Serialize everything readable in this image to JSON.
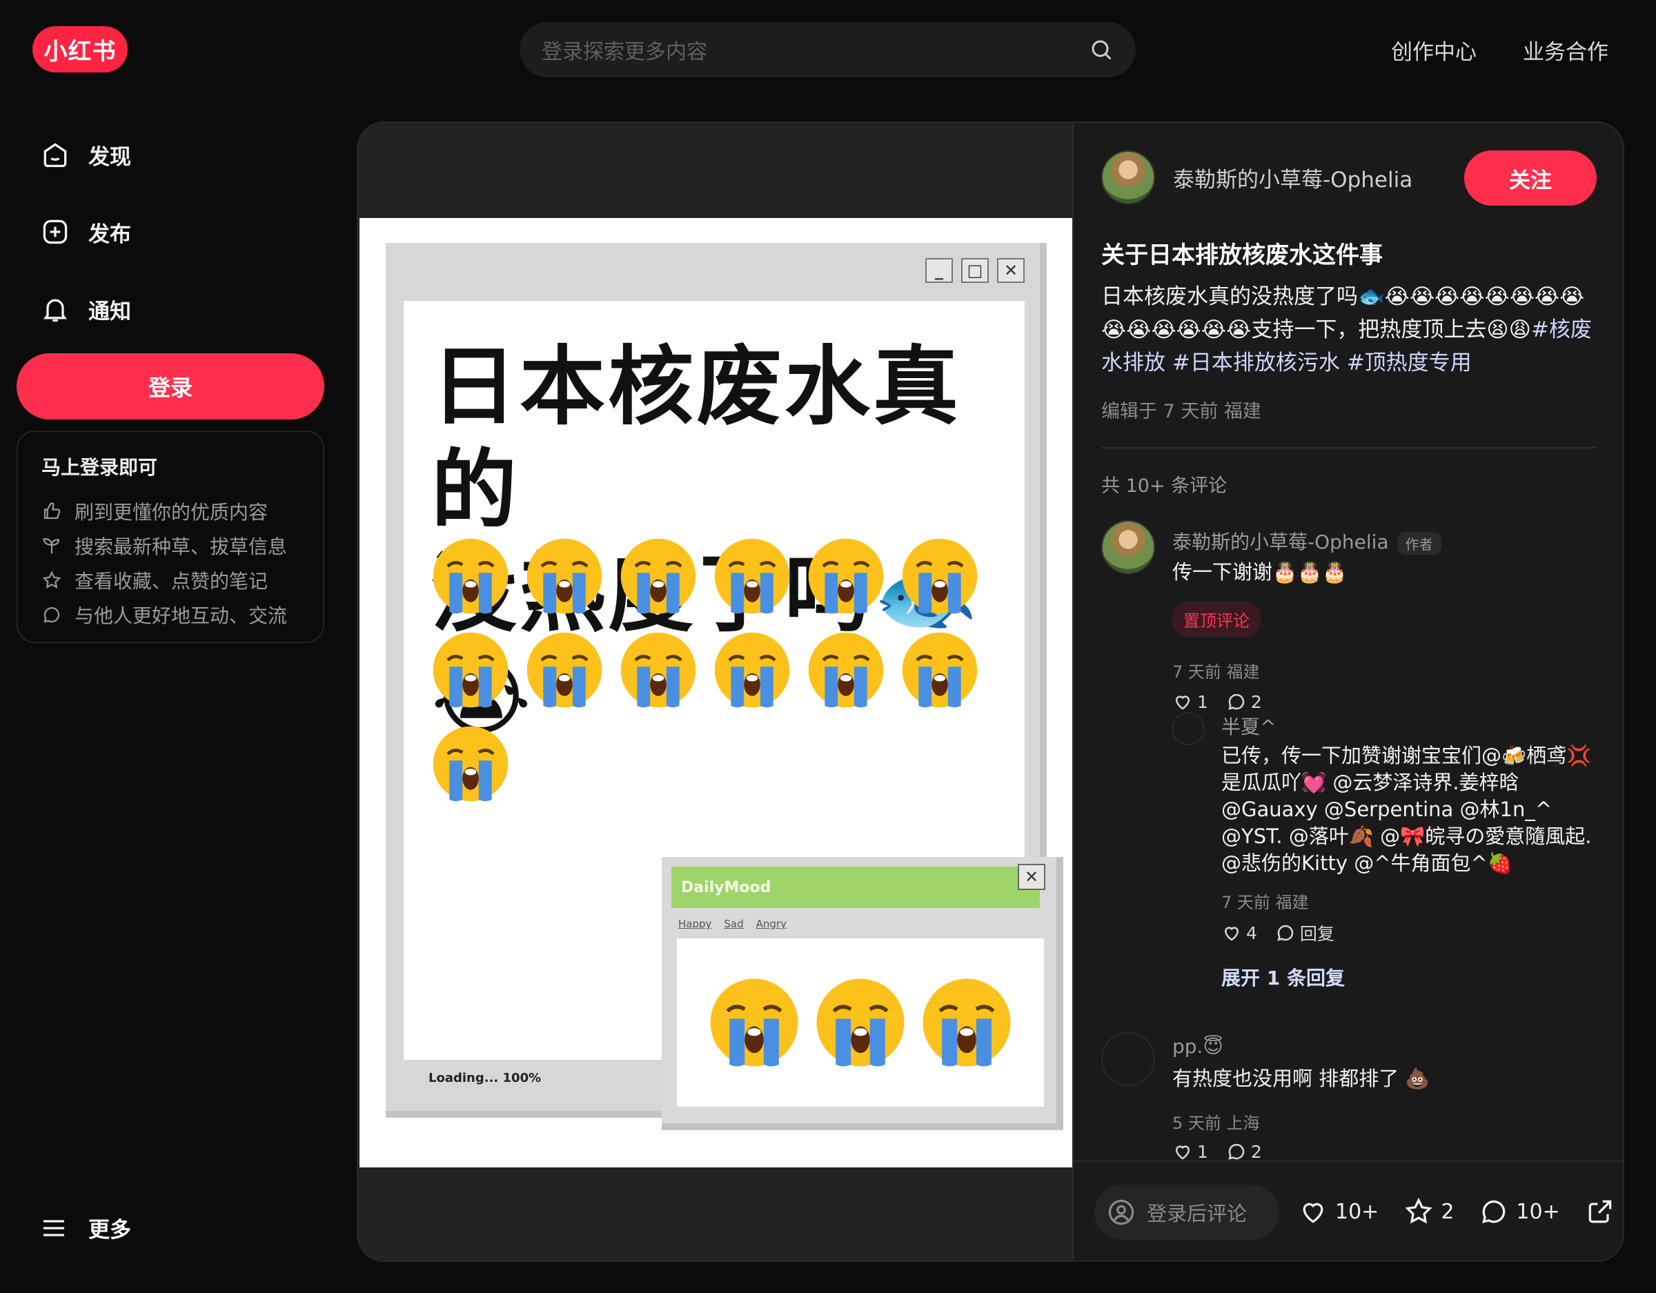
{
  "header": {
    "logo": "小红书",
    "search_placeholder": "登录探索更多内容",
    "links": [
      "创作中心",
      "业务合作"
    ]
  },
  "sidebar": {
    "items": [
      {
        "label": "发现",
        "icon": "home-icon"
      },
      {
        "label": "发布",
        "icon": "plus-square-icon"
      },
      {
        "label": "通知",
        "icon": "bell-icon"
      }
    ],
    "login_button": "登录",
    "login_card": {
      "title": "马上登录即可",
      "benefits": [
        {
          "text": "刷到更懂你的优质内容",
          "icon": "thumbs-up-icon"
        },
        {
          "text": "搜索最新种草、拔草信息",
          "icon": "sprout-icon"
        },
        {
          "text": "查看收藏、点赞的笔记",
          "icon": "star-icon"
        },
        {
          "text": "与他人更好地互动、交流",
          "icon": "chat-bubble-icon"
        }
      ]
    },
    "more": "更多"
  },
  "media": {
    "headline_line1": "日本核废水真的",
    "headline_line2": "没热度了吗🐟😭",
    "loading_text": "Loading... 100%",
    "mood_window_title": "DailyMood",
    "mood_menu": [
      "Happy",
      "Sad",
      "Angry"
    ]
  },
  "note": {
    "author": "泰勒斯的小草莓-Ophelia",
    "follow_label": "关注",
    "title": "关于日本排放核废水这件事",
    "desc_text": "日本核废水真的没热度了吗🐟😭😭😭😭😭😭😭😭😭😭😭😭😭😭支持一下，把热度顶上去😫😩",
    "tags": [
      "#核废水排放",
      "#日本排放核污水",
      "#顶热度专用"
    ],
    "meta": "编辑于 7 天前 福建",
    "comment_count": "共 10+ 条评论"
  },
  "comments": [
    {
      "name": "泰勒斯的小草莓-Ophelia",
      "author_tag": "作者",
      "text": "传一下谢谢🎂🎂🎂",
      "pinned": "置顶评论",
      "meta": "7 天前 福建",
      "likes": "1",
      "replies": "2"
    },
    {
      "name": "半夏^",
      "text": "已传，传一下加赞谢谢宝宝们@🍻栖鸢💢是瓜瓜吖💓 @云梦泽诗界.姜梓晗 @Gauaxy @Serpentina @林1n_^ @YST. @落叶🍂 @🎀皖寻の愛意隨風起. @悲伤的Kitty @^牛角面包^🍓",
      "meta": "7 天前 福建",
      "likes": "4",
      "reply_label": "回复",
      "expand": "展开 1 条回复"
    },
    {
      "name": "pp.😇",
      "text": "有热度也没用啊 排都排了 💩",
      "meta": "5 天前 上海",
      "likes": "1",
      "replies": "2"
    }
  ],
  "bottom": {
    "input_placeholder": "登录后评论",
    "likes": "10+",
    "collects": "2",
    "comments": "10+"
  },
  "colors": {
    "brand": "#ff2442",
    "background": "#0b0b0b",
    "panel": "#1a1a1a"
  }
}
